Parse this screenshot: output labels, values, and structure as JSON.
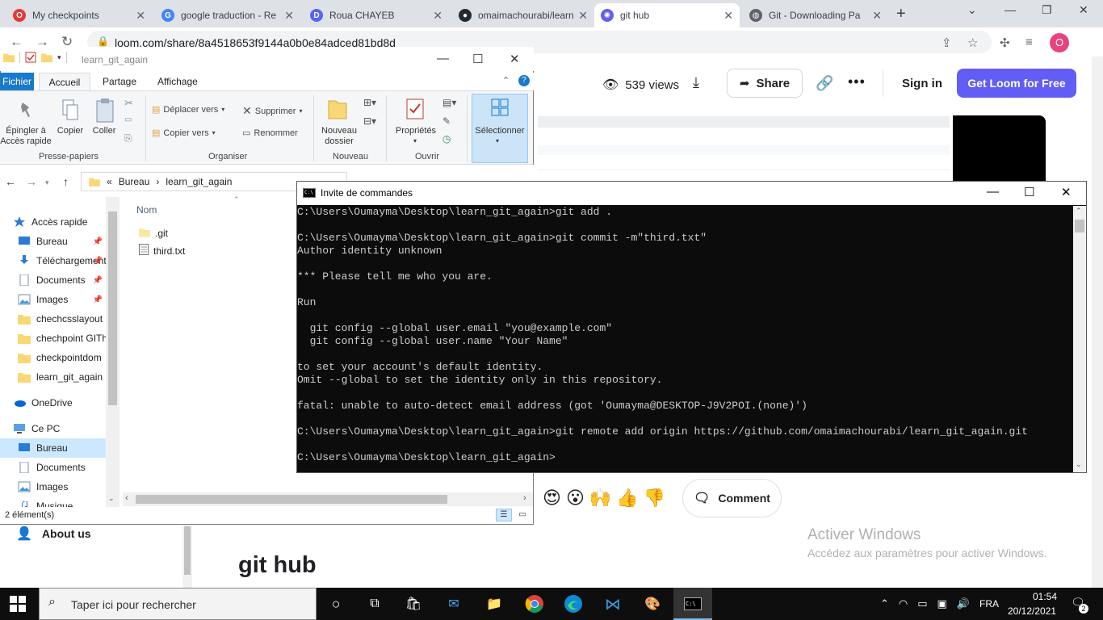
{
  "browser": {
    "tabs": [
      {
        "title": "My checkpoints",
        "active": false,
        "icon": "opera-icon"
      },
      {
        "title": "google traduction - Re",
        "active": false,
        "icon": "google-icon"
      },
      {
        "title": "Roua CHAYEB",
        "active": false,
        "icon": "discord-icon"
      },
      {
        "title": "omaimachourabi/learn",
        "active": false,
        "icon": "github-icon"
      },
      {
        "title": "git hub",
        "active": true,
        "icon": "loom-icon"
      },
      {
        "title": "Git - Downloading Pa",
        "active": false,
        "icon": "globe-icon"
      }
    ],
    "url": "loom.com/share/8a4518653f9144a0b0e84adced81bd8d",
    "profile_initial": "O"
  },
  "loom": {
    "views": "539 views",
    "share_label": "Share",
    "signin_label": "Sign in",
    "get_loom_label": "Get Loom for Free",
    "comment_label": "Comment",
    "reactions": [
      "😍",
      "😮",
      "🙌",
      "👍",
      "👎"
    ],
    "about_label": "About us",
    "page_title": "git hub",
    "accent_color": "#625df5",
    "activate_title": "Activer Windows",
    "activate_sub": "Accédez aux paramètres pour activer Windows."
  },
  "explorer": {
    "title": "learn_git_again",
    "ribbon_tabs": {
      "fichier": "Fichier",
      "accueil": "Accueil",
      "partage": "Partage",
      "affichage": "Affichage"
    },
    "ribbon": {
      "epingler": "Épingler à\nAccès rapide",
      "copier": "Copier",
      "coller": "Coller",
      "deplacer": "Déplacer vers",
      "copier_vers": "Copier vers",
      "supprimer": "Supprimer",
      "renommer": "Renommer",
      "nouveau_dossier": "Nouveau\ndossier",
      "proprietes": "Propriétés",
      "selectionner": "Sélectionner",
      "groups": {
        "presse": "Presse-papiers",
        "organiser": "Organiser",
        "nouveau": "Nouveau",
        "ouvrir": "Ouvrir"
      }
    },
    "breadcrumb": [
      "Bureau",
      "learn_git_again"
    ],
    "nav_items": [
      {
        "label": "Accès rapide",
        "type": "star"
      },
      {
        "label": "Bureau",
        "type": "desktop",
        "pinned": true
      },
      {
        "label": "Téléchargements",
        "type": "download",
        "pinned": true
      },
      {
        "label": "Documents",
        "type": "doc",
        "pinned": true
      },
      {
        "label": "Images",
        "type": "image",
        "pinned": true
      },
      {
        "label": "chechcsslayout",
        "type": "folder"
      },
      {
        "label": "chechpoint GITh",
        "type": "folder"
      },
      {
        "label": "checkpointdom",
        "type": "folder"
      },
      {
        "label": "learn_git_again",
        "type": "folder"
      },
      {
        "label": "OneDrive",
        "type": "cloud"
      },
      {
        "label": "Ce PC",
        "type": "pc"
      },
      {
        "label": "Bureau",
        "type": "desktop",
        "selected": true
      },
      {
        "label": "Documents",
        "type": "doc"
      },
      {
        "label": "Images",
        "type": "image"
      },
      {
        "label": "Musique",
        "type": "music"
      }
    ],
    "column_name": "Nom",
    "files": [
      {
        "name": ".git",
        "type": "folder"
      },
      {
        "name": "third.txt",
        "type": "text"
      }
    ],
    "status": "2 élément(s)"
  },
  "cmd": {
    "title": "Invite de commandes",
    "lines": [
      "C:\\Users\\Oumayma\\Desktop\\learn_git_again>git add .",
      "",
      "C:\\Users\\Oumayma\\Desktop\\learn_git_again>git commit -m\"third.txt\"",
      "Author identity unknown",
      "",
      "*** Please tell me who you are.",
      "",
      "Run",
      "",
      "  git config --global user.email \"you@example.com\"",
      "  git config --global user.name \"Your Name\"",
      "",
      "to set your account's default identity.",
      "Omit --global to set the identity only in this repository.",
      "",
      "fatal: unable to auto-detect email address (got 'Oumayma@DESKTOP-J9V2POI.(none)')",
      "",
      "C:\\Users\\Oumayma\\Desktop\\learn_git_again>git remote add origin https://github.com/omaimachourabi/learn_git_again.git",
      "",
      "C:\\Users\\Oumayma\\Desktop\\learn_git_again>"
    ]
  },
  "taskbar": {
    "search_placeholder": "Taper ici pour rechercher",
    "lang": "FRA",
    "time": "01:54",
    "date": "20/12/2021",
    "notif_count": "2"
  }
}
